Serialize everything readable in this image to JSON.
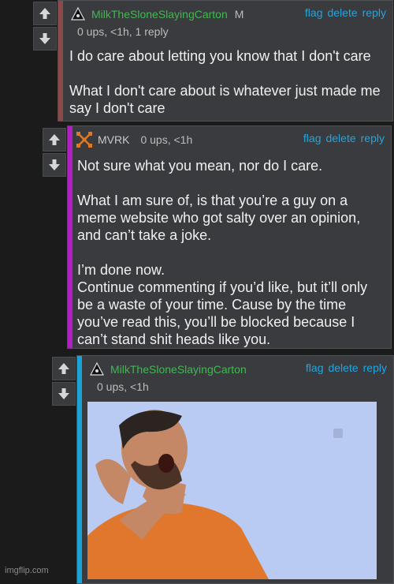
{
  "comments": [
    {
      "username": "MilkTheSloneSlayingCarton",
      "user_tag": "M",
      "meta": "0 ups, <1h, 1 reply",
      "body": "I do care about letting you know that I don't care\n\nWhat I don't care about is whatever just made me say I don't care",
      "username_color": "#3fb950",
      "bar_color": "#8a4a4a",
      "avatar_icon": "spade-triangle-icon"
    },
    {
      "username": "MVRK",
      "meta": "0 ups, <1h",
      "body": "Not sure what you mean, nor do I care.\n\nWhat I am sure of, is that you’re a guy on a meme website who got salty over an opinion, and can’t take a joke.\n\nI’m done now.\nContinue commenting if you’d like, but it’ll only be a waste of your time. Cause by the time you’ve read this, you’ll be blocked because I can’t stand shit heads like you.",
      "username_color": "#c9c9c9",
      "bar_color": "#b21fc4",
      "avatar_icon": "orange-x-icon"
    },
    {
      "username": "MilkTheSloneSlayingCarton",
      "meta": "0 ups, <1h",
      "username_color": "#3fb950",
      "bar_color": "#1aa3d6",
      "avatar_icon": "spade-triangle-icon",
      "image_description_icon": "laughing-man-gif"
    }
  ],
  "actions": {
    "flag": "flag",
    "delete": "delete",
    "reply": "reply"
  },
  "watermark": "imgflip.com",
  "colors": {
    "action_link": "#22a5e0",
    "card_bg": "#3a3b3e"
  }
}
